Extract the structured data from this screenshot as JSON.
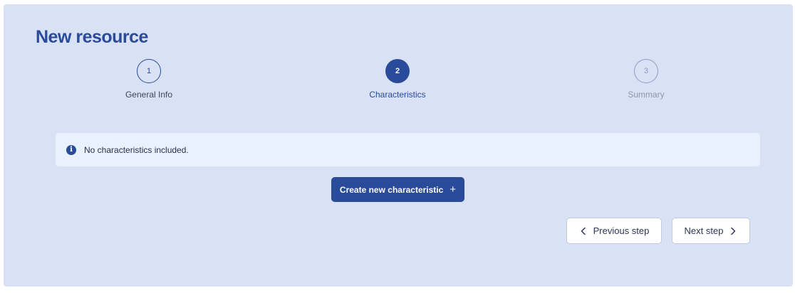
{
  "page": {
    "title": "New resource"
  },
  "stepper": {
    "steps": [
      {
        "number": "1",
        "label": "General Info",
        "state": "completed"
      },
      {
        "number": "2",
        "label": "Characteristics",
        "state": "active"
      },
      {
        "number": "3",
        "label": "Summary",
        "state": "pending"
      }
    ]
  },
  "info": {
    "icon": "info-icon",
    "message": "No characteristics included."
  },
  "actions": {
    "create_label": "Create new characteristic",
    "create_icon": "plus-icon",
    "prev_label": "Previous step",
    "prev_icon": "chevron-left-icon",
    "next_label": "Next step",
    "next_icon": "chevron-right-icon"
  },
  "colors": {
    "primary": "#2a4a9a",
    "panel_background": "#d9e2f4",
    "info_background": "#e8f1fd"
  }
}
